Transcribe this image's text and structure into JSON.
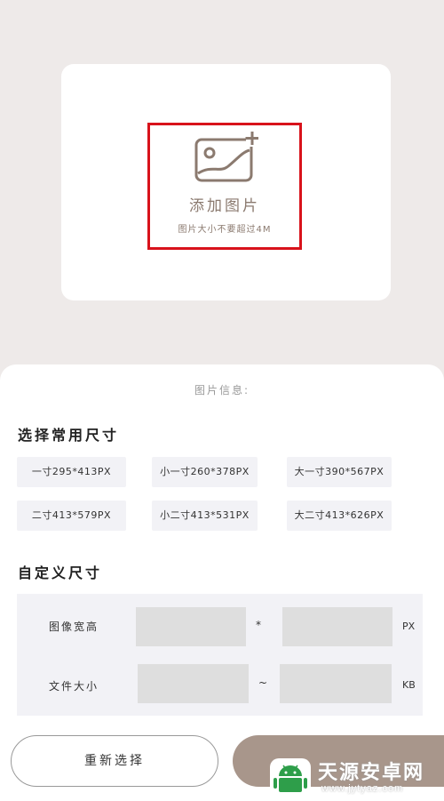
{
  "upload": {
    "add_label": "添加图片",
    "size_limit": "图片大小不要超过4M"
  },
  "info": {
    "title": "图片信息:"
  },
  "presets": {
    "title": "选择常用尺寸",
    "items": [
      {
        "label": "一寸295*413PX"
      },
      {
        "label": "小一寸260*378PX"
      },
      {
        "label": "大一寸390*567PX"
      },
      {
        "label": "二寸413*579PX"
      },
      {
        "label": "小二寸413*531PX"
      },
      {
        "label": "大二寸413*626PX"
      }
    ]
  },
  "custom": {
    "title": "自定义尺寸",
    "dimension_label": "图像宽高",
    "dimension_separator": "*",
    "dimension_unit": "PX",
    "filesize_label": "文件大小",
    "filesize_separator": "~",
    "filesize_unit": "KB",
    "width_value": "",
    "height_value": "",
    "min_size_value": "",
    "max_size_value": ""
  },
  "actions": {
    "reset_label": "重新选择"
  },
  "watermark": {
    "name": "天源安卓网",
    "url": "www.jytyaz.com"
  },
  "colors": {
    "background": "#eeeae9",
    "highlight_border": "#d8121b",
    "accent": "#a8968b",
    "icon": "#8b7a6f"
  }
}
